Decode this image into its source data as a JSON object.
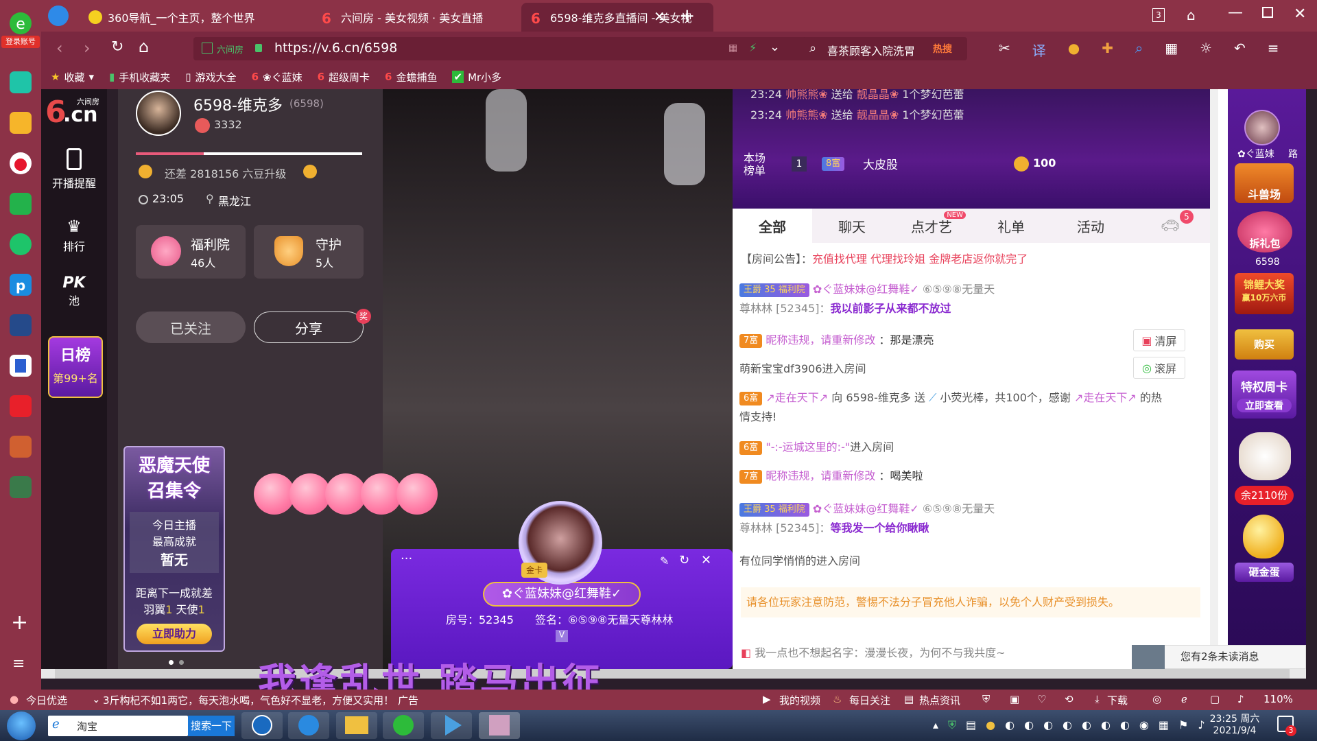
{
  "browser": {
    "tabs": [
      {
        "label": "360导航_一个主页，整个世界",
        "active": false
      },
      {
        "label": "六间房 - 美女视频 · 美女直播",
        "active": false
      },
      {
        "label": "6598-维克多直播间 - 美女视",
        "active": true
      }
    ],
    "tab_count": "3",
    "url_prefix": "六间房",
    "url": "https://v.6.cn/6598",
    "search_text": "喜茶顾客入院洗胃",
    "search_hot": "热搜",
    "bookmarks": [
      "收藏",
      "手机收藏夹",
      "游戏大全",
      "❀ぐ蓝妹",
      "超级周卡",
      "金蟾捕鱼",
      "Mr小多"
    ],
    "login_label": "登录账号"
  },
  "sidenav": {
    "logo_text": "六间房",
    "logo_domain": ".cn",
    "logo_num": "6",
    "items": [
      {
        "label": "开播提醒",
        "icon": "phone-icon"
      },
      {
        "label": "排行",
        "icon": "crown-icon"
      },
      {
        "label": "池",
        "icon": "pk-icon",
        "top_text": "PK"
      }
    ],
    "daily_rank_title": "日榜",
    "daily_rank_value": "第99+名"
  },
  "streamer": {
    "name": "6598-维克多",
    "room_id": "(6598)",
    "heat": "3332",
    "upgrade_text": "还差 2818156 六豆升级",
    "time": "23:05",
    "location": "黑龙江",
    "level_progress": 0.3,
    "welfare_label": "福利院",
    "welfare_count": "46人",
    "guard_label": "守护",
    "guard_count": "5人",
    "followed_label": "已关注",
    "share_label": "分享",
    "share_badge": "奖"
  },
  "event_banner": {
    "title1": "恶魔天使",
    "title2": "召集令",
    "line1": "今日主播",
    "line2": "最高成就",
    "line3": "暂无",
    "line4": "距离下一成就差",
    "line5a": "羽翼",
    "line5b": "1",
    "line5c": "天使",
    "line5d": "1",
    "button": "立即助力"
  },
  "gift_popup": {
    "nickname": "✿ぐ蓝妹妹@红舞鞋✓",
    "room": "房号：52345",
    "sign": "签名：⑥⑤⑨⑧无量天尊林林",
    "avatar_badge": "金卡"
  },
  "subtitle": "我逢乱世 踏马出征",
  "chat": {
    "top_gifts": [
      {
        "time": "23:24",
        "from": "帅熊熊❀",
        "verb": "送给",
        "to": "靓晶晶❀",
        "gift": "1个梦幻芭蕾"
      },
      {
        "time": "23:24",
        "from": "帅熊熊❀",
        "verb": "送给",
        "to": "靓晶晶❀",
        "gift": "1个梦幻芭蕾"
      }
    ],
    "board_label1": "本场",
    "board_label2": "榜单",
    "board_rank": "1",
    "board_badge": "8富",
    "board_user": "大皮股",
    "board_coins": "100",
    "tabs": [
      {
        "label": "全部",
        "active": true
      },
      {
        "label": "聊天",
        "active": false
      },
      {
        "label": "点才艺",
        "active": false,
        "badge": "NEW"
      },
      {
        "label": "礼单",
        "active": false
      },
      {
        "label": "活动",
        "active": false
      }
    ],
    "car_badge": "5",
    "notice_label": "【房间公告】：",
    "notice_text": "充值找代理 代理找玲姐 金牌老店返你就完了",
    "clear_label": "清屏",
    "scroll_label": "滚屏",
    "msgs": {
      "m1_badges": "王爵 35 福利院",
      "m1_user": "✿ぐ蓝妹妹@红舞鞋✓",
      "m1_sign": "⑥⑤⑨⑧无量天",
      "m1_cont": "尊林林 [52345]：",
      "m1_text": "我以前影子从来都不放过",
      "m2_badge": "7富",
      "m2_user": "昵称违规，请重新修改",
      "m2_text": "：那是漂亮",
      "m3_text": "萌新宝宝df3906进入房间",
      "m4_badge": "6富",
      "m4_user": "↗走在天下↗",
      "m4_mid": " 向 6598-维克多 送",
      "m4_gift": "小荧光棒，共100个，感谢",
      "m4_user2": "↗走在天下↗",
      "m4_tail": " 的热",
      "m4_tail2": "情支持!",
      "m5_badge": "6富",
      "m5_user": "\"-:-运城这里的:-\"",
      "m5_text": "进入房间",
      "m6_badge": "7富",
      "m6_user": "昵称违规，请重新修改",
      "m6_text": "：喝美啦",
      "m7_badges": "王爵 35 福利院",
      "m7_user": "✿ぐ蓝妹妹@红舞鞋✓",
      "m7_sign": "⑥⑤⑨⑧无量天",
      "m7_cont": "尊林林 [52345]：",
      "m7_text": "等我发一个给你瞅瞅",
      "m8_text": "有位同学悄悄的进入房间"
    },
    "warning": "请各位玩家注意防范，警惕不法分子冒充他人诈骗，以免个人财产受到损失。",
    "private_msg": "我一点也不想起名字：漫漫长夜，为何不与我共度~",
    "unread_text": "您有2条未读消息",
    "unread_count": "2"
  },
  "rightrail": {
    "user": "✿ぐ蓝妹",
    "user2": "路",
    "tag1": "斗兽场",
    "tag2": "拆礼包",
    "room": "6598",
    "tag3a": "锦鲤大奖",
    "tag3b": "赢10万六币",
    "tag4": "购买",
    "tag5": "特权周卡",
    "tag5b": "立即查看",
    "balance": "余2110份",
    "tag6": "砸金蛋"
  },
  "statusbar": {
    "left1": "今日优选",
    "left2": "3斤构杞不如1两它，每天泡水喝，气色好不显老，方便又实用！",
    "ad": "广告",
    "right": [
      "我的视频",
      "每日关注",
      "热点资讯"
    ],
    "download": "下载",
    "zoom": "110%"
  },
  "taskbar": {
    "search_label": "淘宝",
    "search_btn": "搜索一下",
    "time": "23:25 周六",
    "date": "2021/9/4",
    "notif": "3"
  },
  "colors": {
    "chrome": "#8c3247",
    "accent_pink": "#e0527a",
    "gold": "#f0b030",
    "purple": "#8a3ad0"
  }
}
